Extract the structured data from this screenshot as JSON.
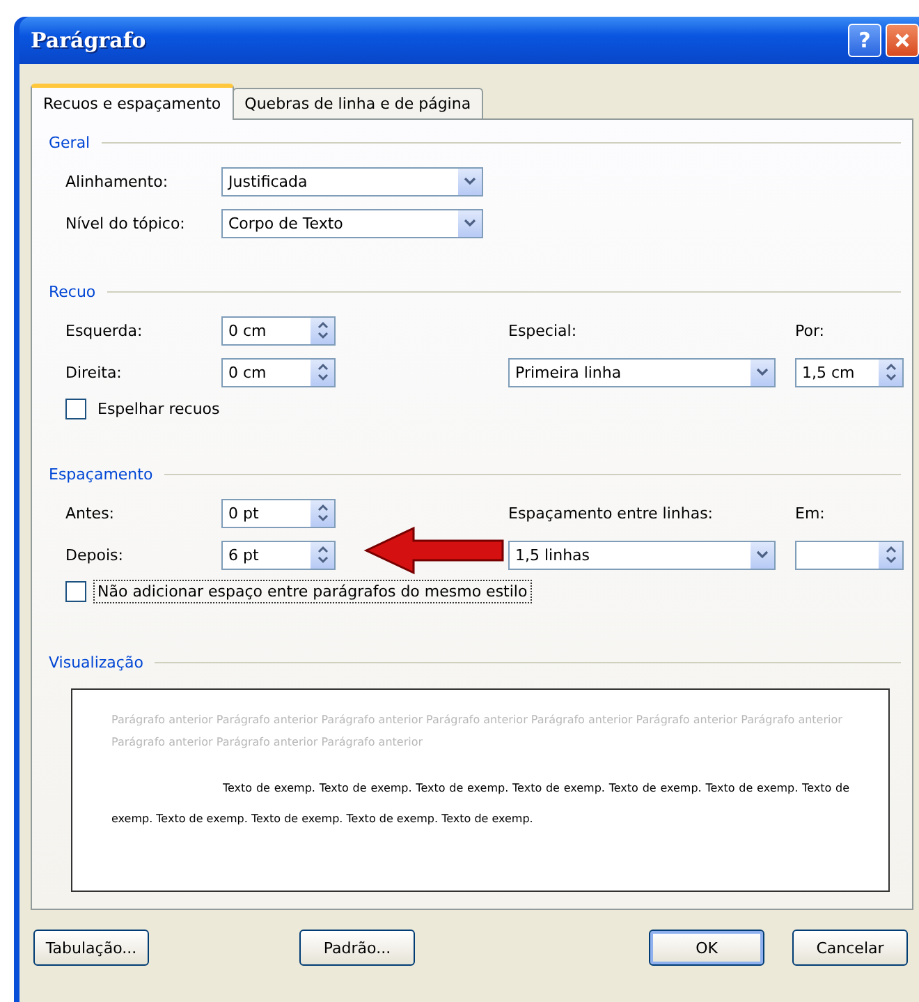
{
  "window": {
    "title": "Parágrafo",
    "help_label": "?"
  },
  "tabs": [
    {
      "label": "Recuos e espaçamento",
      "selected": true
    },
    {
      "label": "Quebras de linha e de página",
      "selected": false
    }
  ],
  "general": {
    "title": "Geral",
    "fields": [
      {
        "label": "Alinhamento:",
        "value": "Justificada"
      },
      {
        "label": "Nível do tópico:",
        "value": "Corpo de Texto"
      }
    ]
  },
  "indent": {
    "title": "Recuo",
    "left": {
      "label": "Esquerda:",
      "value": "0 cm"
    },
    "right": {
      "label": "Direita:",
      "value": "0 cm"
    },
    "special": {
      "label": "Especial:",
      "value": "Primeira linha"
    },
    "by": {
      "label": "Por:",
      "value": "1,5 cm"
    },
    "mirror": {
      "label": "Espelhar recuos",
      "checked": false,
      "focused": false
    }
  },
  "spacing": {
    "title": "Espaçamento",
    "before": {
      "label": "Antes:",
      "value": "0 pt"
    },
    "after": {
      "label": "Depois:",
      "value": "6 pt"
    },
    "line_spacing": {
      "label": "Espaçamento entre linhas:",
      "value": "1,5 linhas"
    },
    "at": {
      "label": "Em:"
    },
    "no_space": {
      "label": "Não adicionar espaço entre parágrafos do mesmo estilo",
      "checked": false,
      "focused": true
    }
  },
  "preview": {
    "title": "Visualização",
    "previous_text": "Parágrafo anterior Parágrafo anterior Parágrafo anterior Parágrafo anterior Parágrafo anterior Parágrafo anterior Parágrafo anterior Parágrafo anterior Parágrafo anterior Parágrafo anterior",
    "sample_text": "Texto de exemp. Texto de exemp. Texto de exemp. Texto de exemp. Texto de exemp. Texto de exemp. Texto de exemp. Texto de exemp. Texto de exemp. Texto de exemp. Texto de exemp."
  },
  "buttons": [
    {
      "label": "Tabulação...",
      "default": false
    },
    {
      "label": "Padrão...",
      "default": false
    },
    {
      "label": "OK",
      "default": true
    },
    {
      "label": "Cancelar",
      "default": false
    }
  ]
}
